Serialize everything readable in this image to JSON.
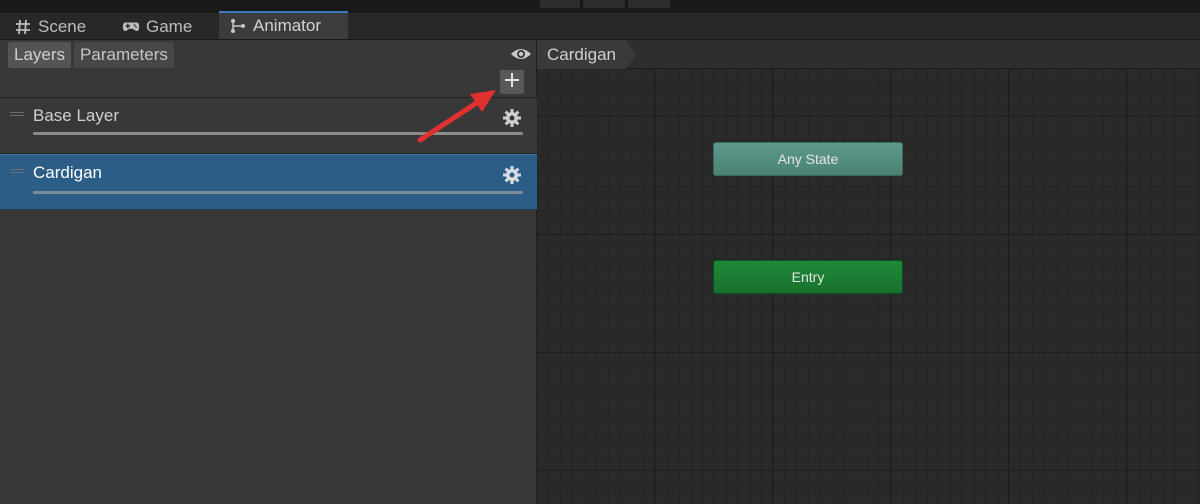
{
  "tabs": [
    {
      "label": "Scene",
      "icon": "hash-icon"
    },
    {
      "label": "Game",
      "icon": "gamepad-icon"
    },
    {
      "label": "Animator",
      "icon": "animator-icon",
      "active": true
    }
  ],
  "left_panel": {
    "subtabs": [
      "Layers",
      "Parameters"
    ],
    "layers": [
      {
        "name": "Base Layer",
        "selected": false
      },
      {
        "name": "Cardigan",
        "selected": true
      }
    ]
  },
  "graph": {
    "breadcrumb": "Cardigan",
    "nodes": {
      "any_state": "Any State",
      "entry": "Entry"
    }
  },
  "colors": {
    "accent": "#3a79bb",
    "selected_layer": "#2c5d87",
    "any_state_node": "#4f8a7c",
    "entry_node": "#1b7a33",
    "annotation_arrow": "#e03030"
  }
}
